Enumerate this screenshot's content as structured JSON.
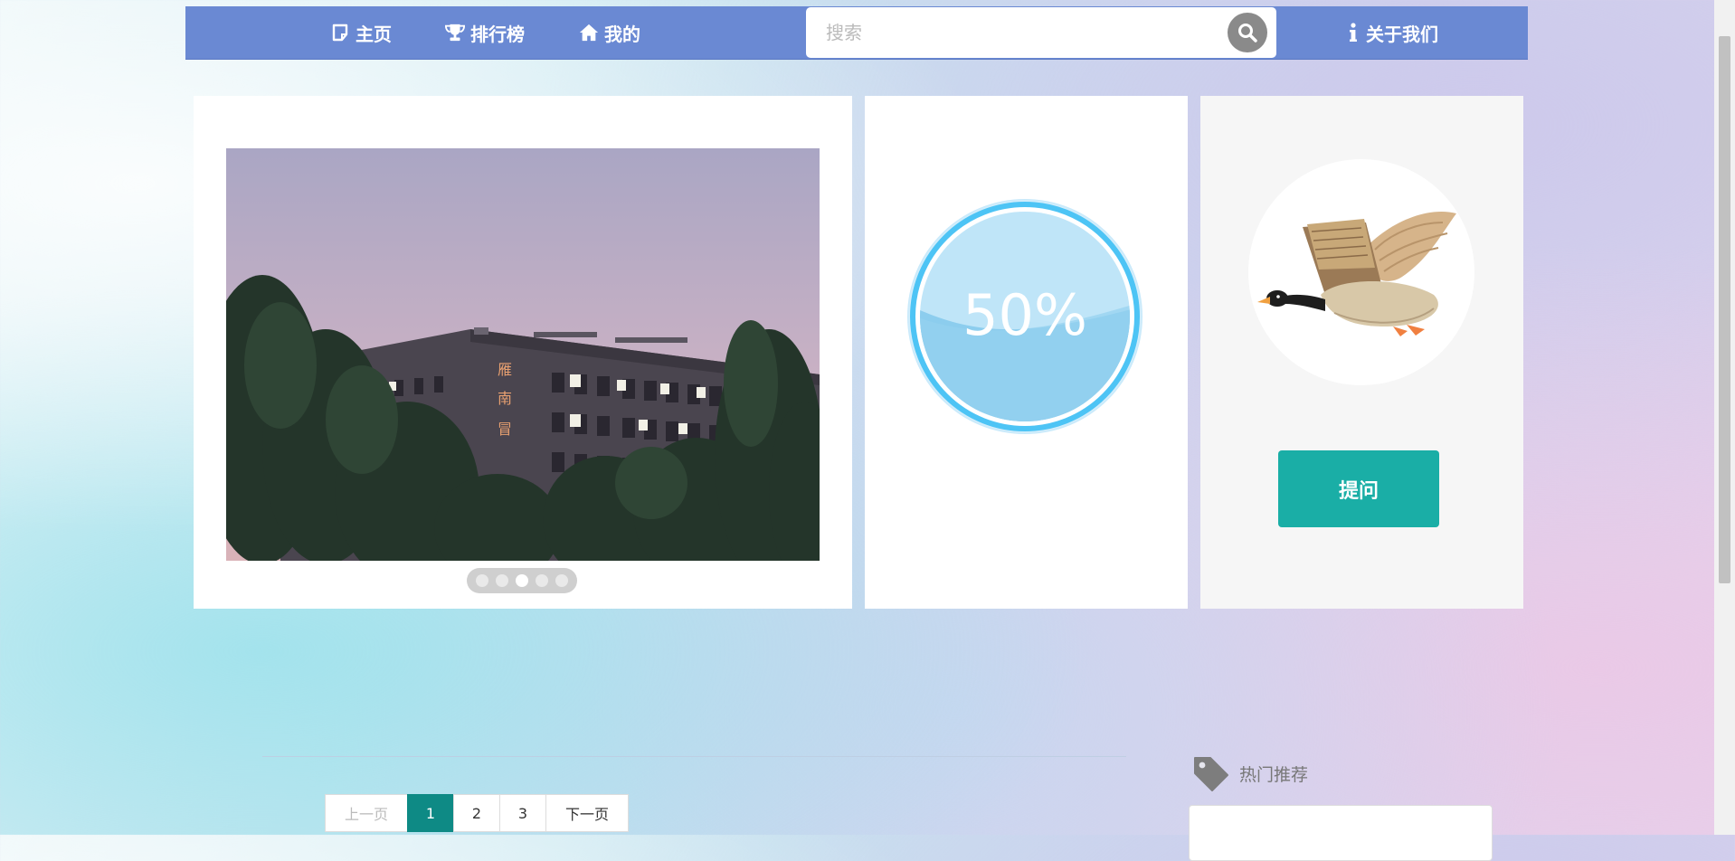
{
  "nav": {
    "home_label": "主页",
    "ranking_label": "排行榜",
    "mine_label": "我的",
    "about_label": "关于我们",
    "search_placeholder": "搜索"
  },
  "carousel": {
    "building_sign": [
      "雁",
      "南",
      "冒"
    ],
    "active_dot_index": 2,
    "dot_count": 5
  },
  "progress": {
    "text": "50%",
    "percent": 50,
    "color": "#4dc4f5"
  },
  "ask": {
    "button_label": "提问",
    "button_color": "#1aaea6"
  },
  "pagination": {
    "prev_label": "上一页",
    "pages": [
      "1",
      "2",
      "3"
    ],
    "current": "1",
    "next_label": "下一页"
  },
  "sidebar": {
    "hot_title": "热门推荐"
  },
  "colors": {
    "navbar": "#6a89d3",
    "active_page": "#0e8a85"
  }
}
